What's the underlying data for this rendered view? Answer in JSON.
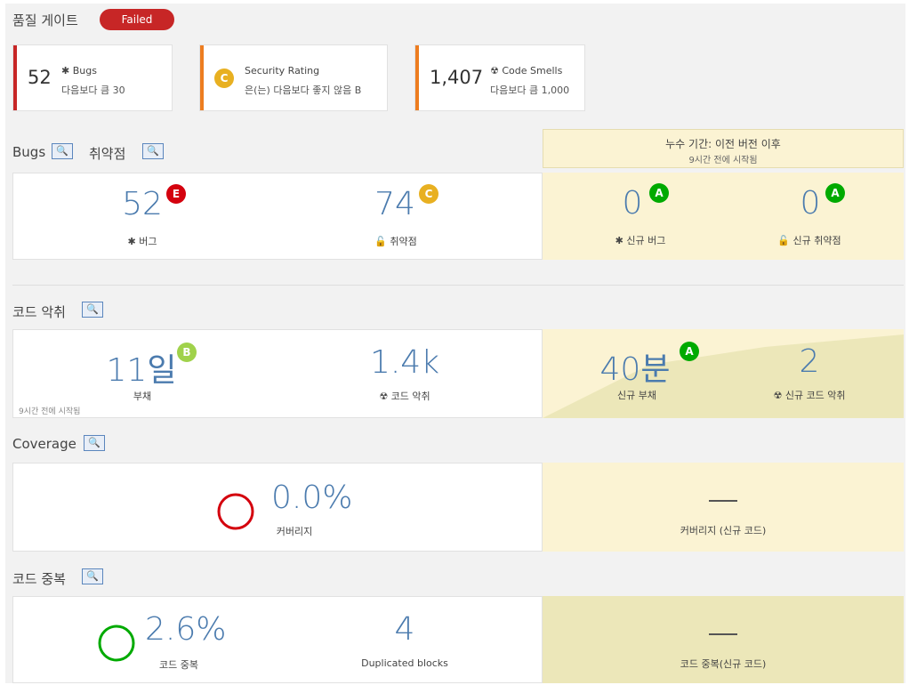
{
  "gate": {
    "title": "품질 게이트",
    "status": "Failed"
  },
  "conditions": [
    {
      "value": "52",
      "icon": "bug-icon",
      "metric": "Bugs",
      "threshold": "다음보다 큼 30",
      "bar_color": "#d4020e"
    },
    {
      "value": "",
      "icon": "rating-c",
      "rating": "C",
      "metric": "Security Rating",
      "threshold": "은(는) 다음보다 좋지 않음 B",
      "bar_color": "#ed7d20"
    },
    {
      "value": "1,407",
      "icon": "code-smell-icon",
      "metric": "Code Smells",
      "threshold": "다음보다 큼 1,000",
      "bar_color": "#ed7d20"
    }
  ],
  "leak": {
    "title": "누수 기간: 이전 버전 이후",
    "started": "9시간 전에 시작됨"
  },
  "sections": {
    "bugs": {
      "title1": "Bugs",
      "title2": "취약점",
      "help_glyph": "🔍",
      "bugs_value": "52",
      "bugs_rating": "E",
      "bugs_label": "버그",
      "vuln_value": "74",
      "vuln_rating": "C",
      "vuln_label": "취약점",
      "new_bugs_value": "0",
      "new_bugs_rating": "A",
      "new_bugs_label": "신규 버그",
      "new_vuln_value": "0",
      "new_vuln_rating": "A",
      "new_vuln_label": "신규 취약점"
    },
    "smells": {
      "title": "코드 악취",
      "debt_value": "11일",
      "debt_rating": "B",
      "debt_label": "부채",
      "started": "9시간 전에 시작됨",
      "smells_value": "1.4k",
      "smells_label": "코드 악취",
      "new_debt_value": "40분",
      "new_debt_rating": "A",
      "new_debt_label": "신규 부채",
      "new_smells_value": "2",
      "new_smells_label": "신규 코드 악취"
    },
    "coverage": {
      "title": "Coverage",
      "value": "0.0%",
      "label": "커버리지",
      "new_label": "커버리지 (신규 코드)"
    },
    "duplication": {
      "title": "코드 중복",
      "value": "2.6%",
      "label": "코드 중복",
      "blocks_value": "4",
      "blocks_label": "Duplicated blocks",
      "new_label": "코드 중복(신규 코드)"
    }
  },
  "colors": {
    "failed": "#c72626",
    "rating_E": "#d4020e",
    "rating_C": "#e8b021",
    "rating_A": "#00aa00",
    "rating_B": "#a0d24b",
    "leak_bg": "#fbf3d3"
  }
}
